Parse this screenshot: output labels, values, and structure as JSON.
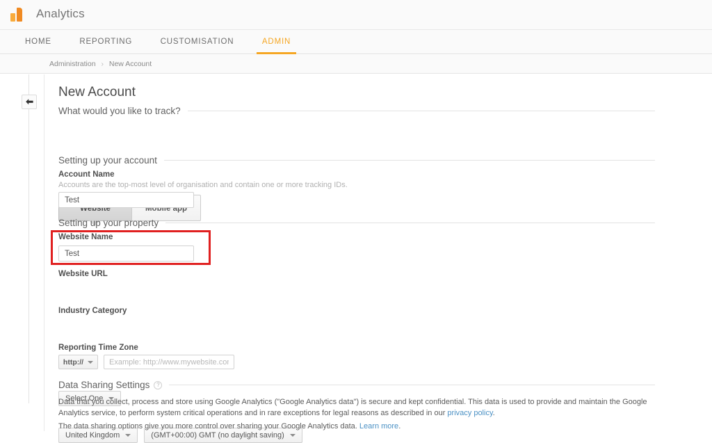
{
  "brand": {
    "name": "Analytics",
    "logo_icon": "analytics-bars-icon",
    "accent_color": "#f5a623"
  },
  "nav": {
    "tabs": [
      {
        "label": "HOME",
        "active": false
      },
      {
        "label": "REPORTING",
        "active": false
      },
      {
        "label": "CUSTOMISATION",
        "active": false
      },
      {
        "label": "ADMIN",
        "active": true
      }
    ]
  },
  "breadcrumb": {
    "root": "Administration",
    "separator": "›",
    "current": "New Account"
  },
  "sidebar": {
    "back_icon": "back-arrow-icon"
  },
  "page": {
    "title": "New Account"
  },
  "track_section": {
    "heading": "What would you like to track?",
    "options": [
      {
        "label": "Website",
        "selected": true
      },
      {
        "label": "Mobile app",
        "selected": false
      }
    ]
  },
  "account_section": {
    "heading": "Setting up your account",
    "account_name": {
      "label": "Account Name",
      "hint": "Accounts are the top-most level of organisation and contain one or more tracking IDs.",
      "value": "Test",
      "placeholder": ""
    }
  },
  "property_section": {
    "heading": "Setting up your property",
    "website_name": {
      "label": "Website Name",
      "value": "Test",
      "placeholder": "",
      "highlight_color": "#e02020"
    },
    "website_url": {
      "label": "Website URL",
      "protocol": "http://",
      "value": "",
      "placeholder": "Example: http://www.mywebsite.com"
    },
    "industry_category": {
      "label": "Industry Category",
      "value": "Select One"
    },
    "reporting_time_zone": {
      "label": "Reporting Time Zone",
      "country": "United Kingdom",
      "zone": "(GMT+00:00) GMT (no daylight saving)"
    }
  },
  "data_sharing": {
    "heading": "Data Sharing Settings",
    "help_icon": "question-mark-icon",
    "paragraph1_before_link": "Data that you collect, process and store using Google Analytics (\"Google Analytics data\") is secure and kept confidential. This data is used to provide and maintain the Google Analytics service, to perform system critical operations and in rare exceptions for legal reasons as described in our ",
    "paragraph1_link": "privacy policy",
    "paragraph1_after_link": ".",
    "paragraph2_before_link": "The data sharing options give you more control over sharing your Google Analytics data. ",
    "paragraph2_link": "Learn more",
    "paragraph2_after_link": "."
  }
}
